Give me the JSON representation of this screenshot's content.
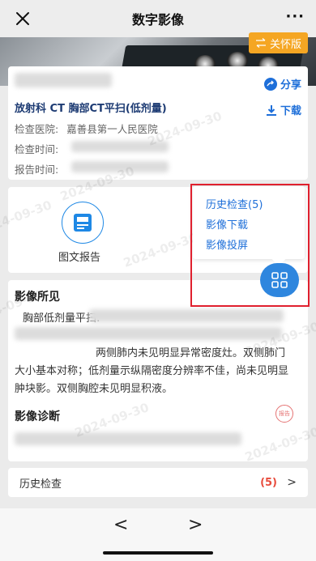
{
  "nav": {
    "title": "数字影像",
    "more": "···"
  },
  "hero": {
    "care_mode": "关怀版"
  },
  "exam": {
    "share": "分享",
    "download": "下载",
    "title": "放射科   CT   胸部CT平扫(低剂量)",
    "hospital_label": "检查医院:",
    "hospital_value": "嘉善县第一人民医院",
    "exam_time_label": "检查时间:",
    "report_time_label": "报告时间:"
  },
  "report": {
    "label": "图文报告"
  },
  "popup": {
    "history": "历史检查(5)",
    "image_download": "影像下载",
    "image_cast": "影像投屏"
  },
  "findings": {
    "title": "影像所见",
    "subtitle": "胸部低剂量平扫:",
    "text": "两侧肺内未见明显异常密度灶。双侧肺门大小基本对称；低剂量示纵隔密度分辨率不佳，尚未见明显肿块影。双侧胸腔未见明显积液。",
    "diagnosis_title": "影像诊断",
    "seal": "报告"
  },
  "history": {
    "label": "历史检查",
    "count": "(5)",
    "chevron": ">"
  },
  "bottom": {
    "prev": "<",
    "next": ">"
  },
  "watermark": "2024-09-30"
}
